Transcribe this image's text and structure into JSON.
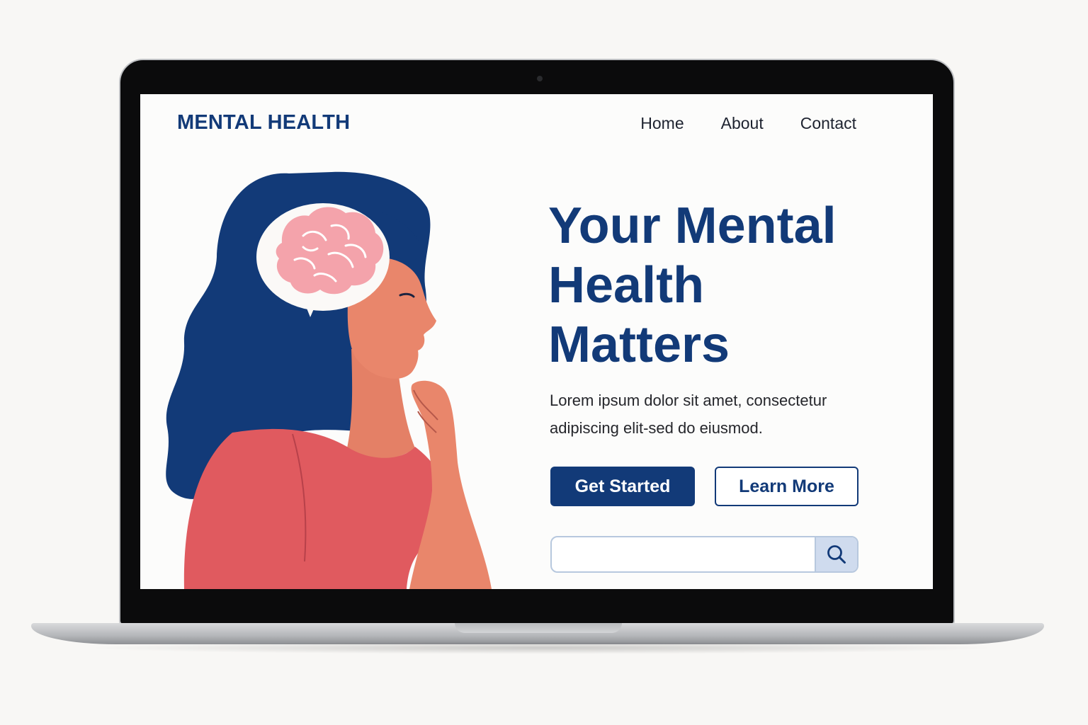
{
  "site": {
    "logo": "MENTAL HEALTH"
  },
  "nav": {
    "items": [
      {
        "label": "Home"
      },
      {
        "label": "About"
      },
      {
        "label": "Contact"
      }
    ]
  },
  "hero": {
    "title_lines": [
      "Your Mental",
      "Health",
      "Matters"
    ],
    "text_lines": [
      "Lorem ipsum dolor sit amet, consectetur",
      "adipiscing elit-sed do eiusmod."
    ],
    "primary_button": "Get Started",
    "secondary_button": "Learn More"
  },
  "search": {
    "value": "",
    "placeholder": "",
    "icon": "search-icon"
  },
  "illustration": {
    "subject": "woman-thinking-with-brain",
    "hair_color": "#123a78",
    "skin_color": "#e9866b",
    "shirt_color": "#e05a5f",
    "brain_color": "#f4a3ab"
  },
  "colors": {
    "brand": "#123a78",
    "background": "#fcfcfb",
    "search_accent": "#cfdbee"
  }
}
